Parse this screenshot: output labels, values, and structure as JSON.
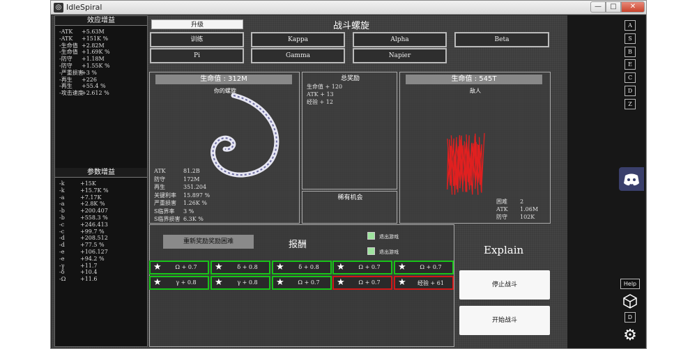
{
  "window": {
    "title": "IdleSpiral",
    "min": "—",
    "max": "□",
    "close": "✕"
  },
  "left": {
    "effects_title": "效应增益",
    "effects": [
      {
        "k": "-ATK",
        "v": "+5.63M"
      },
      {
        "k": "-ATK",
        "v": "+151K %"
      },
      {
        "k": "-生命值",
        "v": "+2.82M"
      },
      {
        "k": "-生命值",
        "v": "+1.69K %"
      },
      {
        "k": "-防守",
        "v": "+1.18M"
      },
      {
        "k": "-防守",
        "v": "+1.55K %"
      },
      {
        "k": "-严重损害",
        "v": "+3 %"
      },
      {
        "k": "-再生",
        "v": "+226"
      },
      {
        "k": "-再生",
        "v": "+55.4 %"
      },
      {
        "k": "-攻击速度",
        "v": "+2.612 %"
      }
    ],
    "params_title": "参数增益",
    "params": [
      {
        "k": "-k",
        "v": "+15K"
      },
      {
        "k": "-k",
        "v": "+15.7K %"
      },
      {
        "k": "-a",
        "v": "+7.17K"
      },
      {
        "k": "-a",
        "v": "+2.8K %"
      },
      {
        "k": "-b",
        "v": "+200.407"
      },
      {
        "k": "-b",
        "v": "+558.3 %"
      },
      {
        "k": "-c",
        "v": "+246.413"
      },
      {
        "k": "-c",
        "v": "+99.7 %"
      },
      {
        "k": "-d",
        "v": "+208.512"
      },
      {
        "k": "-d",
        "v": "+77.5 %"
      },
      {
        "k": "-e",
        "v": "+106.127"
      },
      {
        "k": "-e",
        "v": "+94.2 %"
      },
      {
        "k": "-γ",
        "v": "+11.7"
      },
      {
        "k": "-δ",
        "v": "+10.4"
      },
      {
        "k": "-Ω",
        "v": "+11.6"
      }
    ]
  },
  "top": {
    "upgrade": "升级",
    "title": "战斗螺旋",
    "tabs": [
      "训练",
      "Kappa",
      "Alpha",
      "Beta",
      "Pi",
      "Gamma",
      "Napier"
    ]
  },
  "player": {
    "hp": "生命值 : 312M",
    "label": "你的螺旋",
    "stats": [
      {
        "k": "ATK",
        "v": "81.2B"
      },
      {
        "k": "防守",
        "v": "172M"
      },
      {
        "k": "再生",
        "v": "351.204"
      },
      {
        "k": "关键利率",
        "v": "15.897 %"
      },
      {
        "k": "严重损害",
        "v": "1.26K %"
      },
      {
        "k": "S临界率",
        "v": "3 %"
      },
      {
        "k": "S临界损害",
        "v": "6.3K %"
      }
    ]
  },
  "total_reward": {
    "title": "总奖励",
    "lines": [
      "生命值 + 120",
      "ATK + 13",
      "经验 + 12"
    ]
  },
  "rare": {
    "title": "稀有机会"
  },
  "enemy": {
    "hp": "生命值 : 545T",
    "label": "敌人",
    "stats": [
      {
        "k": "困难",
        "v": "2"
      },
      {
        "k": "ATK",
        "v": "1.06M"
      },
      {
        "k": "防守",
        "v": "102K"
      }
    ]
  },
  "reward": {
    "reset": "重新奖励奖励困难",
    "title": "报酬",
    "check1": "退出游戏",
    "check2": "退出游戏",
    "cells": [
      {
        "t": "Ω + 0.7",
        "color": "#18c418"
      },
      {
        "t": "δ + 0.8",
        "color": "#18c418"
      },
      {
        "t": "δ + 0.8",
        "color": "#18c418"
      },
      {
        "t": "Ω + 0.7",
        "color": "#18c418"
      },
      {
        "t": "Ω + 0.7",
        "color": "#18c418"
      },
      {
        "t": "γ + 0.8",
        "color": "#18c418"
      },
      {
        "t": "γ + 0.8",
        "color": "#18c418"
      },
      {
        "t": "Ω + 0.7",
        "color": "#18c418"
      },
      {
        "t": "Ω + 0.7",
        "color": "#d01818"
      },
      {
        "t": "经验 + 61",
        "color": "#d01818"
      }
    ]
  },
  "right": {
    "letters": [
      "A",
      "S",
      "B",
      "E",
      "C",
      "D",
      "Z"
    ],
    "explain": "Explain",
    "stop": "停止战斗",
    "start": "开始战斗",
    "help": "Help",
    "d": "D"
  },
  "colors": {
    "spiral": "#c8c8e8",
    "enemy_wave": "#e02020",
    "reward_green": "#18c418",
    "reward_red": "#d01818"
  }
}
